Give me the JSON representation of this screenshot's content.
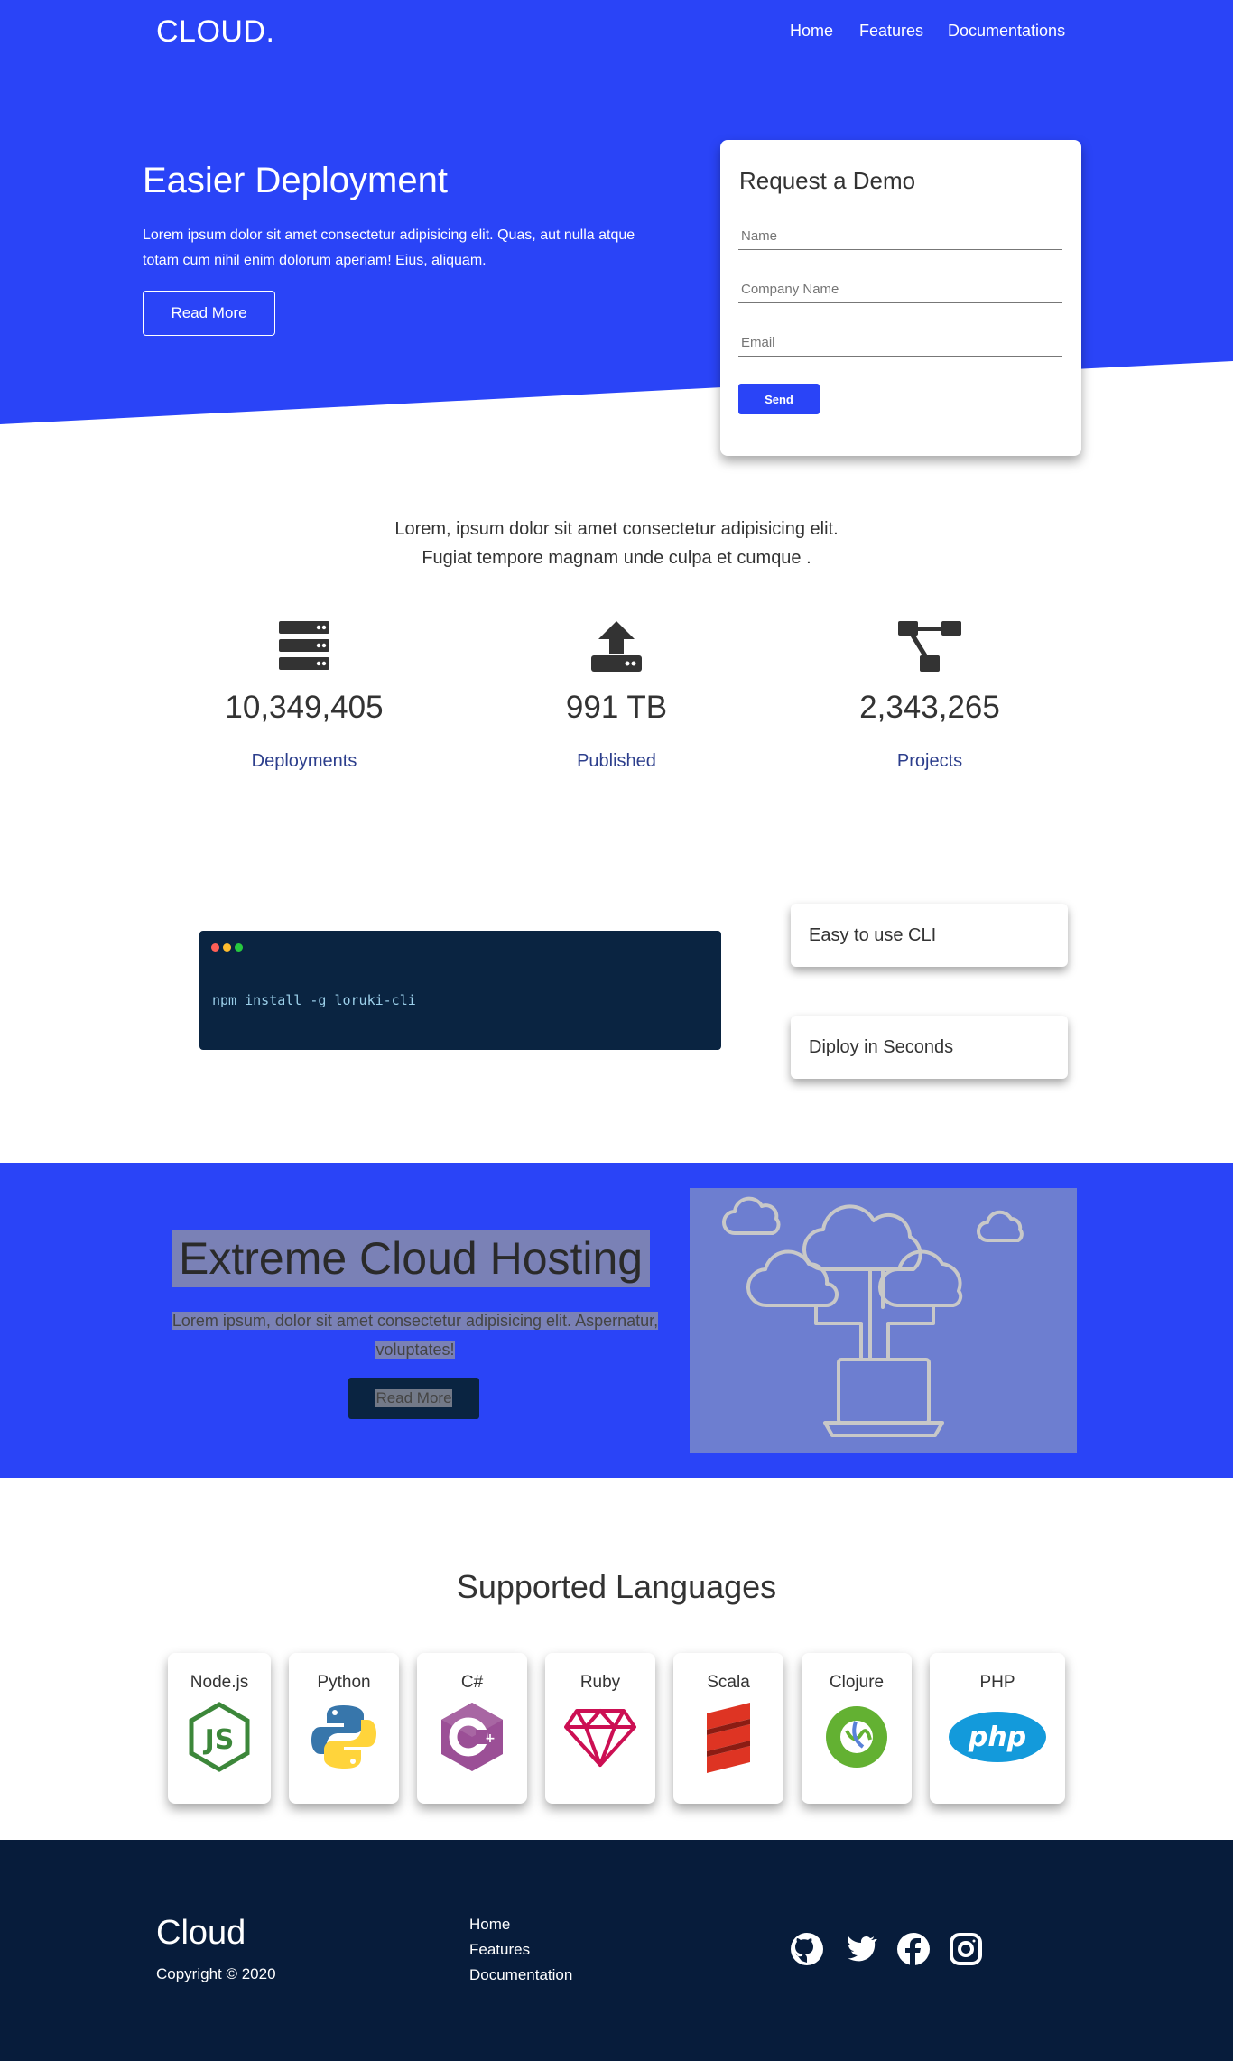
{
  "header": {
    "logo": "CLOUD.",
    "nav": [
      "Home",
      "Features",
      "Documentations"
    ]
  },
  "hero": {
    "title": "Easier Deployment",
    "text": "Lorem ipsum dolor sit amet consectetur adipisicing elit. Quas, aut nulla atque totam cum nihil enim dolorum aperiam! Eius, aliquam.",
    "button": "Read More"
  },
  "demo_form": {
    "title": "Request a Demo",
    "name_placeholder": "Name",
    "company_placeholder": "Company Name",
    "email_placeholder": "Email",
    "send": "Send"
  },
  "stats": {
    "intro_line1": "Lorem, ipsum dolor sit amet consectetur adipisicing elit.",
    "intro_line2": "Fugiat tempore magnam unde culpa et cumque .",
    "items": [
      {
        "icon": "server-icon",
        "value": "10,349,405",
        "label": "Deployments"
      },
      {
        "icon": "upload-icon",
        "value": "991 TB",
        "label": "Published"
      },
      {
        "icon": "project-diagram-icon",
        "value": "2,343,265",
        "label": "Projects"
      }
    ]
  },
  "cli": {
    "command": "npm install -g loruki-cli",
    "features": [
      "Easy to use CLI",
      "Diploy in Seconds"
    ]
  },
  "extreme": {
    "title": "Extreme Cloud Hosting",
    "text_line1": "Lorem ipsum, dolor sit amet consectetur adipisicing elit. Aspernatur,",
    "text_line2": "voluptates!",
    "button": "Read More"
  },
  "languages": {
    "title": "Supported Languages",
    "items": [
      "Node.js",
      "Python",
      "C#",
      "Ruby",
      "Scala",
      "Clojure",
      "PHP"
    ]
  },
  "footer": {
    "brand": "Cloud",
    "copyright": "Copyright © 2020",
    "links": [
      "Home",
      "Features",
      "Documentation"
    ],
    "social": [
      "github-icon",
      "twitter-icon",
      "facebook-icon",
      "instagram-icon"
    ]
  },
  "colors": {
    "primary": "#2a44f7",
    "dark": "#071c3b",
    "terminal": "#0a2441"
  }
}
